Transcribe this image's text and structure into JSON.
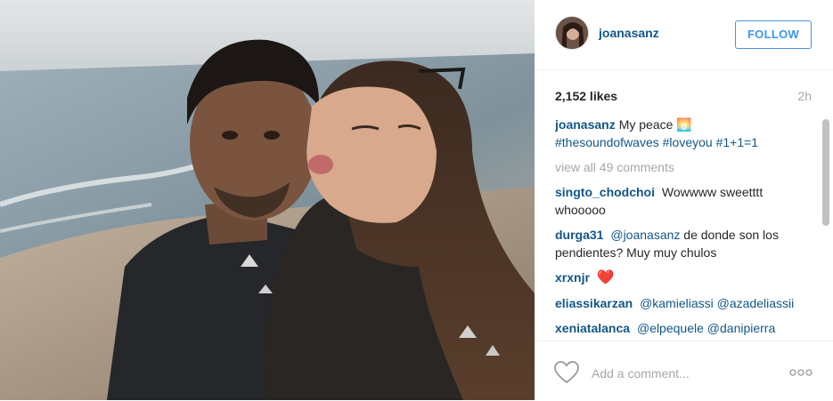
{
  "post": {
    "photo": {
      "description_icon": "selfie-photo"
    },
    "header": {
      "username": "joanasanz",
      "follow_label": "FOLLOW"
    },
    "stats": {
      "likes": "2,152 likes",
      "time": "2h"
    },
    "caption": {
      "author": "joanasanz",
      "text": "My peace",
      "emoji": "🌅",
      "hashtags": "#thesoundofwaves #loveyou #1+1=1"
    },
    "view_all": "view all 49 comments",
    "comments": [
      {
        "author": "singto_chodchoi",
        "text": "Wowwww sweetttt whooooo"
      },
      {
        "author": "durga31",
        "mention": "@joanasanz",
        "text": "de donde son los pendientes? Muy muy chulos"
      },
      {
        "author": "xrxnjr",
        "text": "❤️"
      },
      {
        "author": "eliassikarzan",
        "mention": "@kamieliassi @azadeliassii",
        "text": ""
      },
      {
        "author": "xeniatalanca",
        "mention": "@elpequele @danipierra @cantanton",
        "text": ""
      }
    ],
    "footer": {
      "comment_placeholder": "Add a comment...",
      "like_icon": "heart-icon",
      "more_icon": "more-options-icon"
    },
    "colors": {
      "link": "#125688",
      "follow_border": "#4a90e2",
      "follow_text": "#3897f0",
      "muted": "#a5a7aa"
    }
  }
}
